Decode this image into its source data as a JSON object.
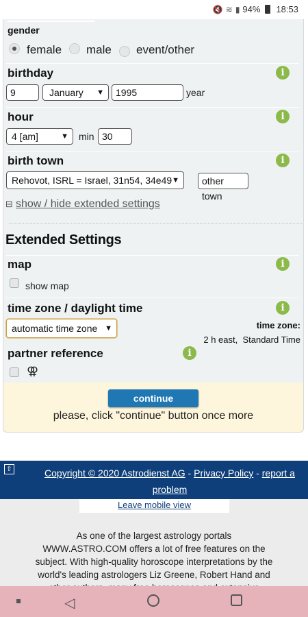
{
  "status": {
    "battery": "94%",
    "time": "18:53"
  },
  "gender": {
    "title": "gender",
    "options": [
      {
        "label": "female",
        "selected": true
      },
      {
        "label": "male",
        "selected": false
      },
      {
        "label": "event/other",
        "selected": false
      }
    ]
  },
  "birthday": {
    "title": "birthday",
    "day": "9",
    "month": "January",
    "year": "1995",
    "year_label": "year"
  },
  "hour": {
    "title": "hour",
    "hour_value": "4 [am]",
    "min_label": "min",
    "min_value": "30"
  },
  "birth_town": {
    "title": "birth town",
    "town_value": "Rehovot, ISRL = Israel, 31n54, 34e49",
    "other_town_label": "other town"
  },
  "toggle_link": {
    "symbol": "⊟",
    "label": "show / hide extended settings"
  },
  "extended": {
    "heading": "Extended Settings",
    "map": {
      "title": "map",
      "checkbox_label": "show map"
    },
    "timezone": {
      "title": "time zone / daylight time",
      "select_value": "automatic time zone",
      "tz_label": "time zone:",
      "tz_value": "2 h east,  Standard Time"
    },
    "partner": {
      "title": "partner reference",
      "symbol": "⚢"
    }
  },
  "continue": {
    "button_label": "continue",
    "note": "please, click \"continue\" button once more"
  },
  "footer": {
    "up_icon": "⇧",
    "copyright": "Copyright © 2020 Astrodienst AG",
    "sep1": " - ",
    "privacy": "Privacy Policy",
    "sep2": " - ",
    "report": "report a problem",
    "leave_mobile": "Leave mobile view",
    "about": "As one of the largest astrology portals WWW.ASTRO.COM offers a lot of free features on the subject. With high-quality horoscope interpretations by the world's leading astrologers Liz Greene, Robert Hand and other authors, many free horoscopes and extensive information on"
  },
  "info_icon": "i",
  "colors": {
    "accent": "#1f77b4",
    "footer": "#0e3f7a",
    "info": "#8cba4a",
    "continue_bg": "#fdf6dc",
    "navbar": "#e5b3b9"
  }
}
